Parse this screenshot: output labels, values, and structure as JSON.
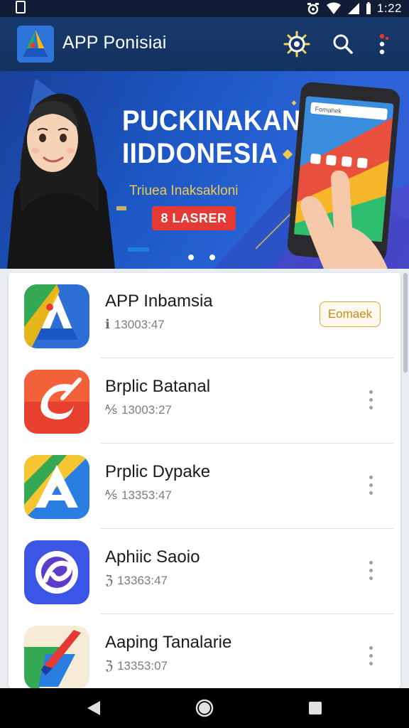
{
  "status_bar": {
    "time": "1:22"
  },
  "app_bar": {
    "title": "APP Ponisiai"
  },
  "banner": {
    "title_line1": "PUCKINAKAN",
    "title_line2": "IIDDONESIA",
    "subtitle": "Triuea Inaksakloni",
    "cta_label": "8 LASRER",
    "phone_search_text": "Fomahek",
    "page_count": 2
  },
  "apps": [
    {
      "name": "APP Inbamsia",
      "meta": "13003:47",
      "meta_icon": "ℹ",
      "action": "Eomaek",
      "icon": "app-a-icon"
    },
    {
      "name": "Brplic Batanal",
      "meta": "13003:27",
      "meta_icon": "⅍",
      "icon": "red-swirl-icon"
    },
    {
      "name": "Prplic Dypake",
      "meta": "13353:47",
      "meta_icon": "⅍",
      "icon": "yellow-a-icon"
    },
    {
      "name": "Aphiic Saoio",
      "meta": "13363:47",
      "meta_icon": "ℨ",
      "icon": "purple-swirl-icon"
    },
    {
      "name": "Aaping Tanalarie",
      "meta": "13353:07",
      "meta_icon": "ℨ",
      "icon": "rocket-icon"
    }
  ],
  "colors": {
    "app_bar": "#173a6e",
    "banner": "#1c57c4",
    "cta": "#e53935",
    "subtitle": "#f2c94c",
    "action_border": "#e0a534"
  }
}
